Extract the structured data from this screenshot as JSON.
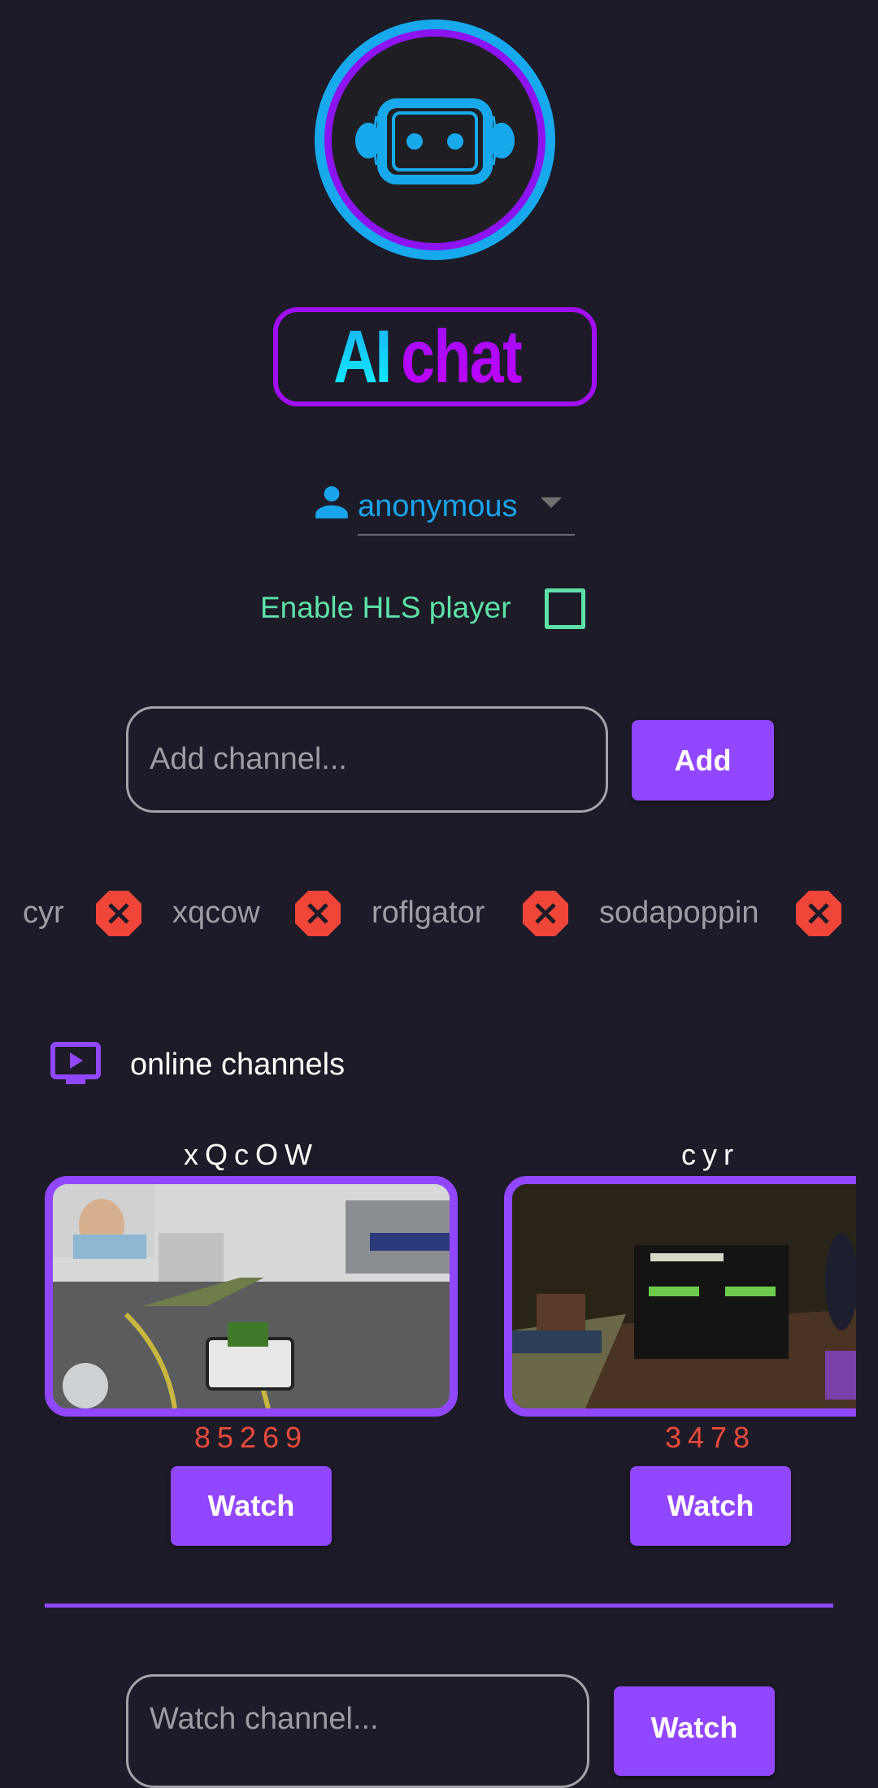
{
  "brand": {
    "logo_icon": "robot-icon",
    "title_part1": "AI",
    "title_part2": "chat",
    "colors": {
      "cyan": "#17a9ec",
      "purple": "#a00ff5",
      "accent": "#9147ff"
    }
  },
  "user": {
    "icon": "person-icon",
    "selected": "anonymous"
  },
  "hls": {
    "label": "Enable HLS player",
    "checked": false
  },
  "add_channel": {
    "placeholder": "Add channel...",
    "value": "",
    "button_label": "Add"
  },
  "saved_channels": [
    {
      "name": "cyr"
    },
    {
      "name": "xqcow"
    },
    {
      "name": "roflgator"
    },
    {
      "name": "sodapoppin"
    }
  ],
  "online": {
    "icon": "tv-play-icon",
    "heading": "online channels",
    "channels": [
      {
        "name": "xQcOW",
        "viewers": "85269",
        "button_label": "Watch"
      },
      {
        "name": "cyr",
        "viewers": "3478",
        "button_label": "Watch"
      }
    ]
  },
  "watch_channel": {
    "placeholder": "Watch channel...",
    "value": "",
    "button_label": "Watch"
  }
}
